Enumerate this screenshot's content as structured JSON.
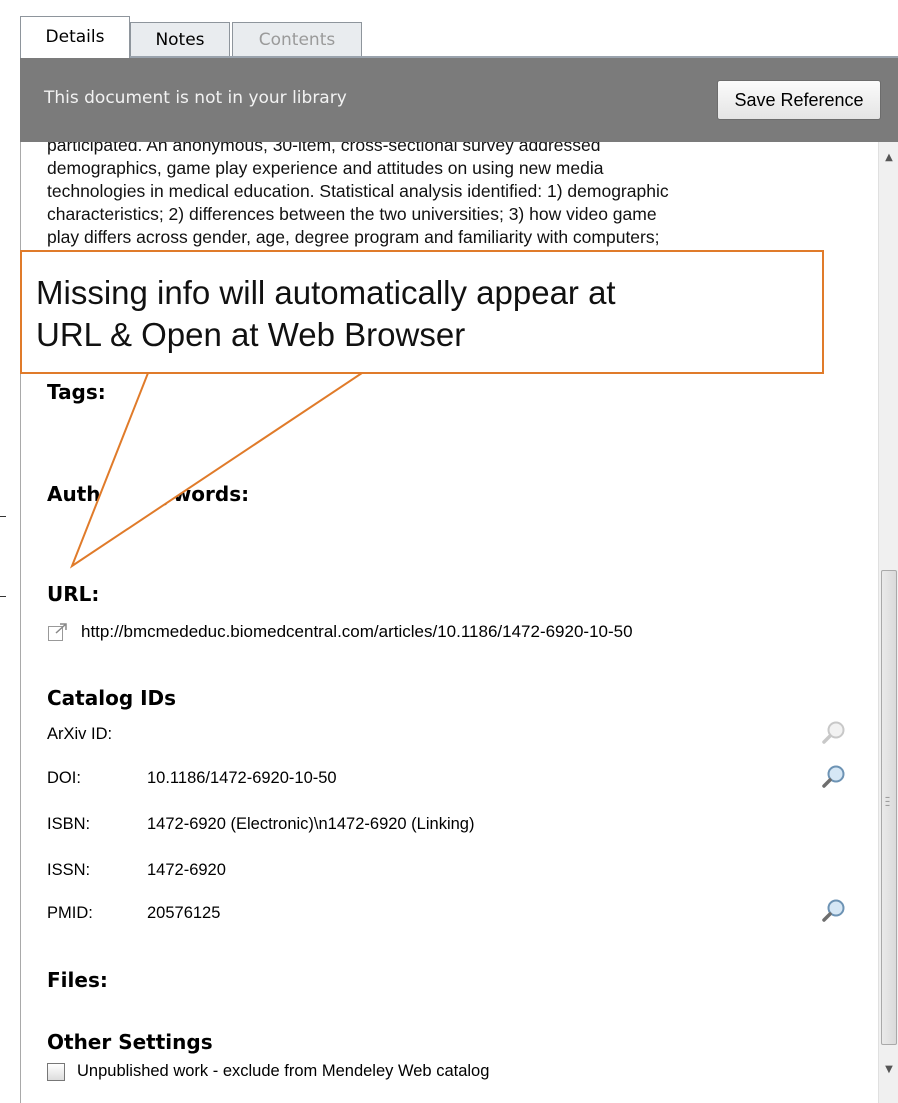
{
  "tabs": [
    {
      "label": "Details",
      "state": "active"
    },
    {
      "label": "Notes",
      "state": "normal"
    },
    {
      "label": "Contents",
      "state": "disabled"
    }
  ],
  "notice": {
    "text": "This document is not in your library",
    "button_label": "Save Reference"
  },
  "abstract_lines": [
    "participated. An anonymous, 30-item, cross-sectional survey addressed",
    "demographics, game play experience and attitudes on using new media",
    "technologies in medical education. Statistical analysis identified: 1) demographic",
    "characteristics; 2) differences between the two universities; 3) how video game",
    "play differs across gender, age, degree program and familiarity with computers;"
  ],
  "sections": {
    "tags": "Tags:",
    "author_keywords": "Author Keywords:",
    "url": "URL:",
    "catalog_ids": "Catalog IDs",
    "files": "Files:",
    "other_settings": "Other Settings"
  },
  "url_value": "http://bmcmededuc.biomedcentral.com/articles/10.1186/1472-6920-10-50",
  "catalog": [
    {
      "label": "ArXiv ID:",
      "value": "",
      "lookup": true,
      "lookup_enabled": false
    },
    {
      "label": "DOI:",
      "value": "10.1186/1472-6920-10-50",
      "lookup": true,
      "lookup_enabled": true
    },
    {
      "label": "ISBN:",
      "value": "1472-6920 (Electronic)\\n1472-6920 (Linking)",
      "lookup": false
    },
    {
      "label": "ISSN:",
      "value": "1472-6920",
      "lookup": false
    },
    {
      "label": "PMID:",
      "value": "20576125",
      "lookup": true,
      "lookup_enabled": true
    }
  ],
  "other_settings": {
    "unpublished_label": "Unpublished work - exclude from Mendeley Web catalog",
    "unpublished_checked": false
  },
  "callout": {
    "line1": "Missing info will automatically appear at",
    "line2": "URL &  Open at Web Browser"
  },
  "colors": {
    "notice_bg": "#7b7b7b",
    "callout_border": "#e07b2a"
  }
}
